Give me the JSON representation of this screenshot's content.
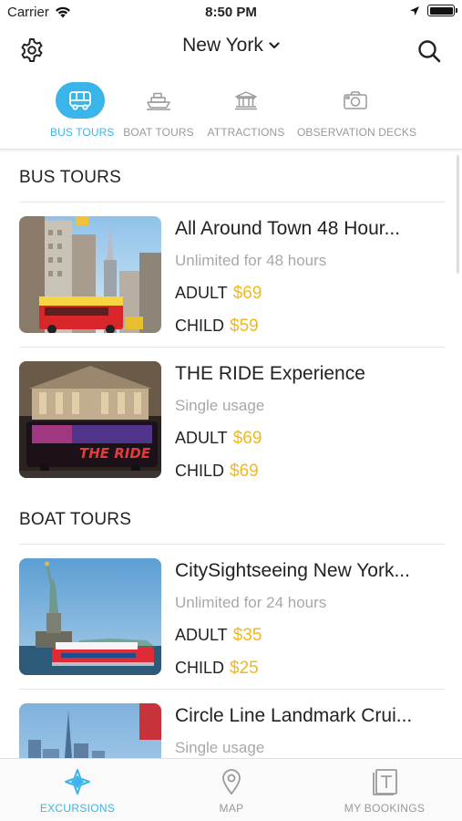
{
  "status": {
    "carrier": "Carrier",
    "time": "8:50 PM"
  },
  "nav": {
    "city": "New York"
  },
  "categories": [
    {
      "label": "BUS TOURS",
      "icon": "bus-icon",
      "active": true
    },
    {
      "label": "BOAT TOURS",
      "icon": "boat-icon",
      "active": false
    },
    {
      "label": "ATTRACTIONS",
      "icon": "museum-icon",
      "active": false
    },
    {
      "label": "OBSERVATION DECKS",
      "icon": "camera-icon",
      "active": false
    }
  ],
  "sections": [
    {
      "title": "BUS TOURS",
      "items": [
        {
          "title": "All Around Town 48 Hour...",
          "subtitle": "Unlimited for 48 hours",
          "adult_label": "ADULT",
          "adult_price": "$69",
          "child_label": "CHILD",
          "child_price": "$59"
        },
        {
          "title": "THE RIDE Experience",
          "subtitle": "Single usage",
          "adult_label": "ADULT",
          "adult_price": "$69",
          "child_label": "CHILD",
          "child_price": "$69"
        }
      ]
    },
    {
      "title": "BOAT TOURS",
      "items": [
        {
          "title": "CitySightseeing New York...",
          "subtitle": "Unlimited for 24 hours",
          "adult_label": "ADULT",
          "adult_price": "$35",
          "child_label": "CHILD",
          "child_price": "$25"
        },
        {
          "title": "Circle Line Landmark Crui...",
          "subtitle": "Single usage"
        }
      ]
    }
  ],
  "tabbar": [
    {
      "label": "EXCURSIONS",
      "icon": "compass-star-icon",
      "active": true
    },
    {
      "label": "MAP",
      "icon": "map-pin-icon",
      "active": false
    },
    {
      "label": "MY BOOKINGS",
      "icon": "ticket-icon",
      "active": false
    }
  ],
  "colors": {
    "accent": "#3ab5ea",
    "price": "#f2b81a"
  }
}
